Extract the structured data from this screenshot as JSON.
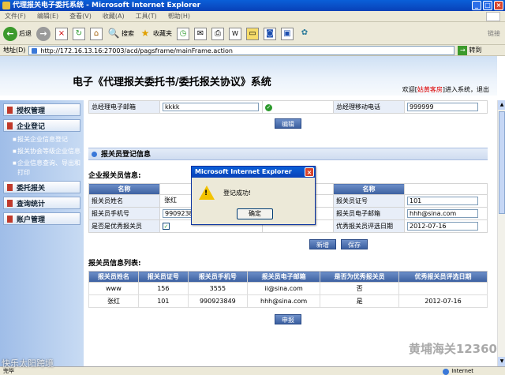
{
  "window": {
    "title": "代理报关电子委托系统 - Microsoft Internet Explorer"
  },
  "menu": [
    "文件(F)",
    "编辑(E)",
    "查看(V)",
    "收藏(A)",
    "工具(T)",
    "帮助(H)"
  ],
  "toolbar": {
    "back": "后退",
    "search": "搜索",
    "favorites": "收藏夹",
    "links": "链接"
  },
  "address": {
    "label": "地址(D)",
    "url": "http://172.16.13.16:27003/acd/pagsframe/mainFrame.action",
    "go": "转到"
  },
  "banner": {
    "title": "电子《代理报关委托书/委托报关协议》系统",
    "welcome_prefix": "欢迎[",
    "welcome_user": "姑黄客房",
    "welcome_suffix": "]进入系统，退出"
  },
  "sidebar": {
    "items": [
      {
        "label": "授权管理"
      },
      {
        "label": "企业登记"
      },
      {
        "label": "委托报关"
      },
      {
        "label": "查询统计"
      },
      {
        "label": "账户管理"
      }
    ],
    "subitems": [
      "报关企业信息登记",
      "报关协会等级企业信息",
      "企业信息查询、导出和打印"
    ]
  },
  "company_form": {
    "row1_label": "总经理电子邮箱",
    "row1_value": "kkkk",
    "row1_right_label": "总经理移动电话",
    "row1_right_value": "999999",
    "edit_button": "编辑"
  },
  "broker_section": {
    "header": "报关员登记信息",
    "subtitle": "企业报关员信息:",
    "col_name": "名称",
    "col_name2": "名称",
    "fields": {
      "name_label": "报关员姓名",
      "name_value": "张红",
      "cert_label": "报关员证号",
      "cert_value": "101",
      "phone_label": "报关员手机号",
      "phone_value": "990923849",
      "email_label": "报关员电子邮箱",
      "email_value": "hhh@sina.com",
      "excellent_label": "是否是优秀报关员",
      "date_label": "优秀报关员评选日期",
      "date_value": "2012-07-16"
    },
    "add_button": "新增",
    "save_button": "保存"
  },
  "broker_list": {
    "title": "报关员信息列表:",
    "headers": [
      "报关员姓名",
      "报关员证号",
      "报关员手机号",
      "报关员电子邮箱",
      "是否为优秀报关员",
      "优秀报关员评选日期"
    ],
    "rows": [
      [
        "www",
        "156",
        "3555",
        "ii@sina.com",
        "否",
        ""
      ],
      [
        "张红",
        "101",
        "990923849",
        "hhh@sina.com",
        "是",
        "2012-07-16"
      ]
    ],
    "submit_button": "申报"
  },
  "dialog": {
    "title": "Microsoft Internet Explorer",
    "message": "登记成功!",
    "ok": "确定"
  },
  "status": {
    "left": "完毕",
    "zone": "Internet"
  },
  "watermarks": {
    "left": "快乐太阳跨境",
    "right": "黄埔海关12360"
  }
}
